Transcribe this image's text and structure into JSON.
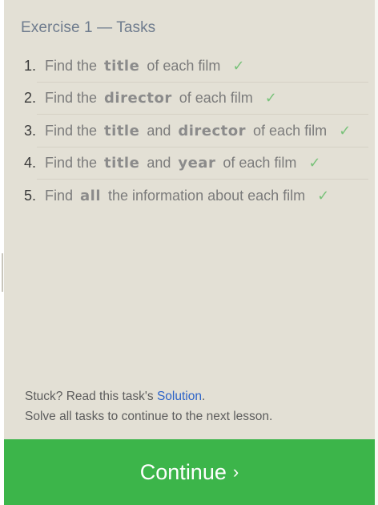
{
  "header": {
    "title": "Exercise 1 — Tasks"
  },
  "tasks": [
    {
      "num": "1.",
      "parts": [
        "Find the",
        "title",
        "of each film"
      ],
      "keywords": [
        1
      ],
      "check": "✓"
    },
    {
      "num": "2.",
      "parts": [
        "Find the",
        "director",
        "of each film"
      ],
      "keywords": [
        1
      ],
      "check": "✓"
    },
    {
      "num": "3.",
      "parts": [
        "Find the",
        "title",
        "and",
        "director",
        "of each film"
      ],
      "keywords": [
        1,
        3
      ],
      "check": "✓"
    },
    {
      "num": "4.",
      "parts": [
        "Find the",
        "title",
        "and",
        "year",
        "of each film"
      ],
      "keywords": [
        1,
        3
      ],
      "check": "✓"
    },
    {
      "num": "5.",
      "parts": [
        "Find",
        "all",
        "the information about each film"
      ],
      "keywords": [
        1
      ],
      "check": "✓"
    }
  ],
  "footer": {
    "stuck_prefix": "Stuck? Read this task's ",
    "solution_link": "Solution",
    "stuck_suffix": ".",
    "line2": "Solve all tasks to continue to the next lesson."
  },
  "continue_button": {
    "label": "Continue",
    "chevron": "›"
  },
  "colors": {
    "panel_bg": "#e3e0d5",
    "check_green": "#79c27a",
    "button_green": "#3cb54a",
    "link_blue": "#2d64c8"
  }
}
